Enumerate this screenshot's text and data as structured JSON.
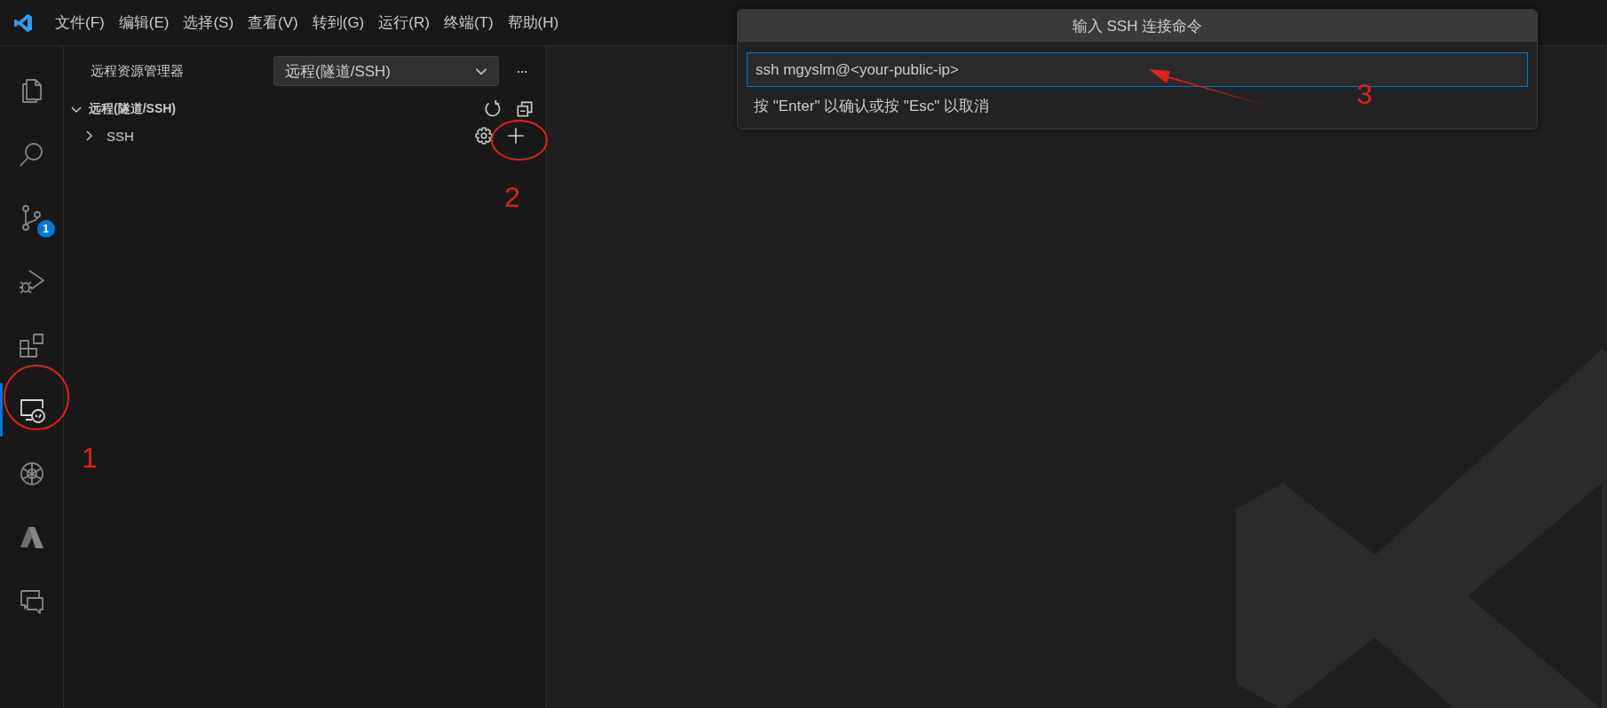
{
  "menu_bar": {
    "items": [
      "文件(F)",
      "编辑(E)",
      "选择(S)",
      "查看(V)",
      "转到(G)",
      "运行(R)",
      "终端(T)",
      "帮助(H)"
    ]
  },
  "activity_bar": {
    "items": [
      {
        "kind": "explorer",
        "selected": false
      },
      {
        "kind": "search",
        "selected": false
      },
      {
        "kind": "source-control",
        "selected": false,
        "badge": "1"
      },
      {
        "kind": "debug",
        "selected": false
      },
      {
        "kind": "extensions",
        "selected": false
      },
      {
        "kind": "remote",
        "selected": true
      },
      {
        "kind": "chatgpt",
        "selected": false
      },
      {
        "kind": "azure",
        "selected": false
      },
      {
        "kind": "chat",
        "selected": false
      }
    ]
  },
  "sidebar": {
    "title": "远程资源管理器",
    "dropdown": {
      "value": "远程(隧道/SSH)"
    },
    "more": "···",
    "section": {
      "title": "远程(隧道/SSH)",
      "expanded": true,
      "items": [
        {
          "label": "SSH",
          "expanded": false
        }
      ]
    }
  },
  "quick_input": {
    "title": "输入 SSH 连接命令",
    "value": "ssh mgyslm@<your-public-ip>",
    "hint": "按 \"Enter\" 以确认或按 \"Esc\" 以取消"
  },
  "annotations": [
    {
      "label": "1"
    },
    {
      "label": "2"
    },
    {
      "label": "3"
    }
  ]
}
